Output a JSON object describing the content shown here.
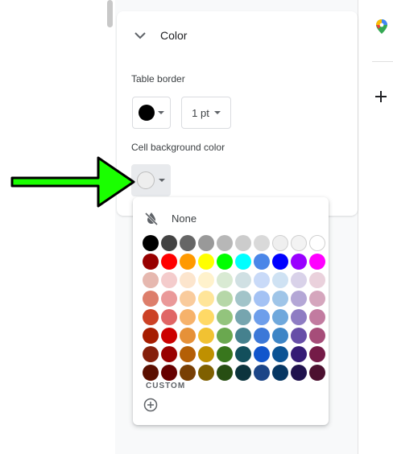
{
  "section": {
    "title": "Color"
  },
  "table_border": {
    "label": "Table border",
    "color": "#000000",
    "weight": "1 pt"
  },
  "cell_background": {
    "label": "Cell background color",
    "color": "#eeeeee"
  },
  "palette": {
    "none_label": "None",
    "custom_label": "CUSTOM",
    "rows": [
      [
        "#000000",
        "#434343",
        "#666666",
        "#999999",
        "#b7b7b7",
        "#cccccc",
        "#d9d9d9",
        "#efefef",
        "#f3f3f3",
        "#ffffff"
      ],
      [
        "#980000",
        "#ff0000",
        "#ff9900",
        "#ffff00",
        "#00ff00",
        "#00ffff",
        "#4a86e8",
        "#0000ff",
        "#9900ff",
        "#ff00ff"
      ],
      [
        "#e6b8af",
        "#f4cccc",
        "#fce5cd",
        "#fff2cc",
        "#d9ead3",
        "#d0e0e3",
        "#c9daf8",
        "#cfe2f3",
        "#d9d2e9",
        "#ead1dc"
      ],
      [
        "#dd7e6b",
        "#ea9999",
        "#f9cb9c",
        "#ffe599",
        "#b6d7a8",
        "#a2c4c9",
        "#a4c2f4",
        "#9fc5e8",
        "#b4a7d6",
        "#d5a6bd"
      ],
      [
        "#cc4125",
        "#e06666",
        "#f6b26b",
        "#ffd966",
        "#93c47d",
        "#76a5af",
        "#6d9eeb",
        "#6fa8dc",
        "#8e7cc3",
        "#c27ba0"
      ],
      [
        "#a61c00",
        "#cc0000",
        "#e69138",
        "#f1c232",
        "#6aa84f",
        "#45818e",
        "#3c78d8",
        "#3d85c6",
        "#674ea7",
        "#a64d79"
      ],
      [
        "#85200c",
        "#990000",
        "#b45f06",
        "#bf9000",
        "#38761d",
        "#134f5c",
        "#1155cc",
        "#0b5394",
        "#351c75",
        "#741b47"
      ],
      [
        "#5b0f00",
        "#660000",
        "#783f04",
        "#7f6000",
        "#274e13",
        "#0c343d",
        "#1c4587",
        "#073763",
        "#20124d",
        "#4c1130"
      ]
    ]
  },
  "annotation": {
    "arrow_color": "#1aff00"
  },
  "icons": {
    "collapse": "chevron-down-icon",
    "none": "format-color-reset-icon",
    "add": "add-circle-icon",
    "maps": "google-maps-icon",
    "plus": "plus-icon"
  }
}
